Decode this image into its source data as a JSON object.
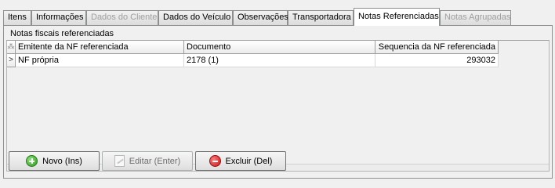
{
  "tabs": [
    {
      "label": "Itens",
      "state": "normal"
    },
    {
      "label": "Informações",
      "state": "normal"
    },
    {
      "label": "Dados do Cliente",
      "state": "disabled"
    },
    {
      "label": "Dados do Veículo",
      "state": "normal"
    },
    {
      "label": "Observações",
      "state": "normal"
    },
    {
      "label": "Transportadora",
      "state": "normal"
    },
    {
      "label": "Notas Referenciadas",
      "state": "active"
    },
    {
      "label": "Notas Agrupadas",
      "state": "disabled"
    }
  ],
  "group": {
    "label": "Notas fiscais referenciadas"
  },
  "grid": {
    "header_indicator": "⁂",
    "columns": [
      "Emitente da NF referenciada",
      "Documento",
      "Sequencia da NF referenciada"
    ],
    "rows": [
      {
        "indicator": ">",
        "emitente": "NF própria",
        "documento": "2178 (1)",
        "sequencia": "293032"
      }
    ]
  },
  "buttons": {
    "novo": {
      "label": "Novo (Ins)",
      "icon": "add-icon"
    },
    "editar": {
      "label": "Editar (Enter)",
      "icon": "edit-icon",
      "state": "disabled"
    },
    "excluir": {
      "label": "Excluir (Del)",
      "icon": "delete-icon"
    }
  }
}
